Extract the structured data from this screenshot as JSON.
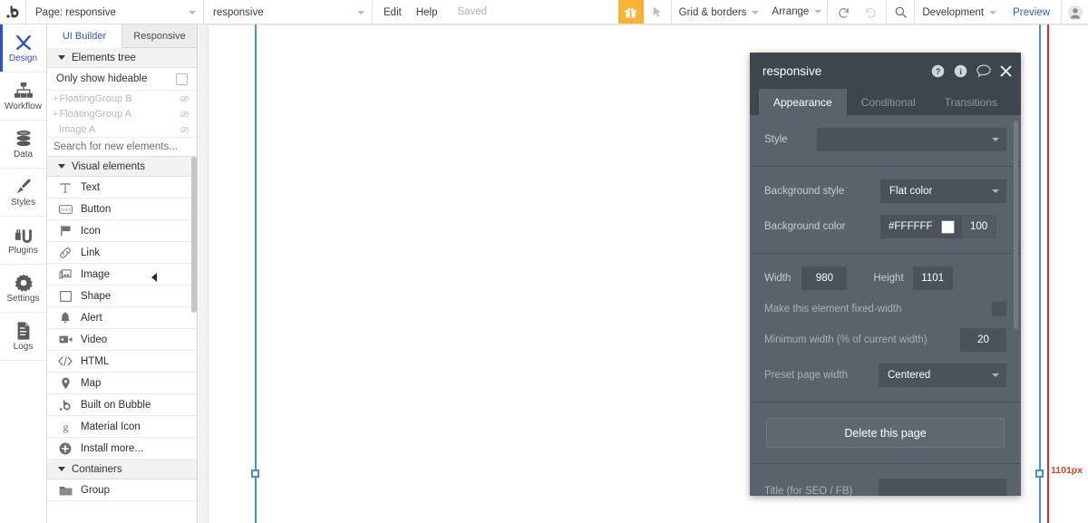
{
  "topbar": {
    "logo": ".b",
    "page_selector": {
      "value": "Page: responsive",
      "icon": "chevron-down-icon"
    },
    "element_selector": {
      "value": "responsive",
      "icon": "chevron-down-icon"
    },
    "menus": [
      "Edit",
      "Help"
    ],
    "save_status": "Saved",
    "gift_icon": "gift-icon",
    "pointer_icon": "cursor-arrow-icon",
    "grid_borders": "Grid & borders",
    "arrange": "Arrange",
    "undo_icon": "undo-icon",
    "redo_icon": "redo-icon",
    "search_icon": "search-icon",
    "version": "Development",
    "preview": "Preview",
    "avatar_icon": "user-avatar-icon"
  },
  "rail": {
    "items": [
      {
        "label": "Design",
        "icon": "design-tools-icon",
        "active": true
      },
      {
        "label": "Workflow",
        "icon": "workflow-tree-icon",
        "active": false
      },
      {
        "label": "Data",
        "icon": "database-icon",
        "active": false
      },
      {
        "label": "Styles",
        "icon": "paintbrush-icon",
        "active": false
      },
      {
        "label": "Plugins",
        "icon": "plugins-icon",
        "active": false
      },
      {
        "label": "Settings",
        "icon": "gear-icon",
        "active": false
      },
      {
        "label": "Logs",
        "icon": "document-lines-icon",
        "active": false
      }
    ]
  },
  "panel": {
    "tabs": [
      {
        "label": "UI Builder",
        "active": true
      },
      {
        "label": "Responsive",
        "active": false
      }
    ],
    "elements_tree": {
      "title": "Elements tree",
      "only_show_hideable": "Only show hideable",
      "checked": false,
      "nodes": [
        {
          "label": "FloatingGroup B",
          "expandable": true,
          "hidden_icon": "eye-slash-icon"
        },
        {
          "label": "FloatingGroup A",
          "expandable": true,
          "hidden_icon": "eye-slash-icon"
        },
        {
          "label": "Image A",
          "expandable": false,
          "hidden_icon": "eye-slash-icon"
        }
      ]
    },
    "search_placeholder": "Search for new elements...",
    "visual_elements": {
      "title": "Visual elements",
      "items": [
        {
          "label": "Text",
          "icon": "text-t-icon"
        },
        {
          "label": "Button",
          "icon": "button-click-icon"
        },
        {
          "label": "Icon",
          "icon": "flag-icon"
        },
        {
          "label": "Link",
          "icon": "link-chain-icon"
        },
        {
          "label": "Image",
          "icon": "image-icon"
        },
        {
          "label": "Shape",
          "icon": "square-shape-icon"
        },
        {
          "label": "Alert",
          "icon": "bell-alert-icon"
        },
        {
          "label": "Video",
          "icon": "video-camera-icon"
        },
        {
          "label": "HTML",
          "icon": "code-brackets-icon"
        },
        {
          "label": "Map",
          "icon": "map-pin-icon"
        },
        {
          "label": "Built on Bubble",
          "icon": "bubble-logo-icon"
        },
        {
          "label": "Material Icon",
          "icon": "material-g-icon"
        },
        {
          "label": "Install more...",
          "icon": "plus-circle-icon"
        }
      ]
    },
    "containers": {
      "title": "Containers",
      "items": [
        {
          "label": "Group",
          "icon": "folder-icon"
        }
      ]
    },
    "collapse_handle_icon": "collapse-left-icon"
  },
  "canvas": {
    "right_edge_label": "1101px",
    "guide_color_blue": "#4a90e2",
    "guide_color_red": "#ee2222",
    "label_color": "#ef3b24"
  },
  "property_editor": {
    "title": "responsive",
    "head_icons": [
      "help-question-icon",
      "info-icon",
      "comment-bubble-icon",
      "close-x-icon"
    ],
    "tabs": [
      {
        "label": "Appearance",
        "active": true
      },
      {
        "label": "Conditional",
        "active": false
      },
      {
        "label": "Transitions",
        "active": false
      }
    ],
    "fields": {
      "style_label": "Style",
      "style_value": "",
      "background_style_label": "Background style",
      "background_style_value": "Flat color",
      "background_color_label": "Background color",
      "background_color_hex": "#FFFFFF",
      "background_color_swatch": "#FFFFFF",
      "background_color_opacity": "100",
      "width_label": "Width",
      "width_value": "980",
      "height_label": "Height",
      "height_value": "1101",
      "fixed_width_label": "Make this element fixed-width",
      "fixed_width_checked": false,
      "min_width_label": "Minimum width (% of current width)",
      "min_width_value": "20",
      "preset_page_width_label": "Preset page width",
      "preset_page_width_value": "Centered",
      "delete_button": "Delete this page",
      "seo_title_label": "Title (for SEO / FB)",
      "seo_title_value": ""
    }
  }
}
